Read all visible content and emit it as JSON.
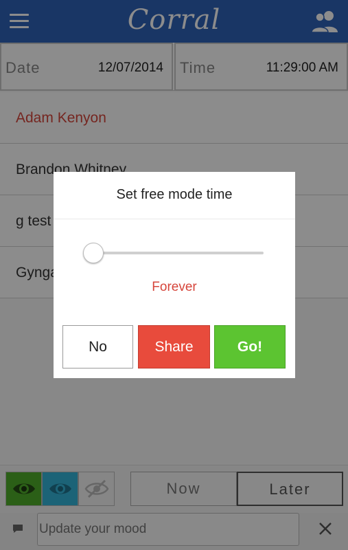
{
  "app": {
    "title": "Corral"
  },
  "datetime": {
    "date_label": "Date",
    "date_value": "12/07/2014",
    "time_label": "Time",
    "time_value": "11:29:00 AM"
  },
  "contacts": [
    {
      "name": "Adam Kenyon",
      "active": true
    },
    {
      "name": "Brandon Whitney",
      "active": false
    },
    {
      "name": "g test",
      "active": false
    },
    {
      "name": "Gyngai Ung",
      "active": false
    }
  ],
  "visibility_buttons": [
    "eye-icon",
    "eye-icon",
    "eye-slash-icon"
  ],
  "timing": {
    "now_label": "Now",
    "later_label": "Later",
    "selected": "Later"
  },
  "mood": {
    "placeholder": "Update your mood"
  },
  "dialog": {
    "title": "Set free mode time",
    "slider_value_label": "Forever",
    "slider_position": 0,
    "no_label": "No",
    "share_label": "Share",
    "go_label": "Go!"
  },
  "colors": {
    "topbar": "#2f63b8",
    "accent_red": "#d6453b",
    "share": "#e84b3c",
    "go": "#5cc431",
    "eye_green": "#4fae2b",
    "eye_blue": "#34b4d9"
  }
}
